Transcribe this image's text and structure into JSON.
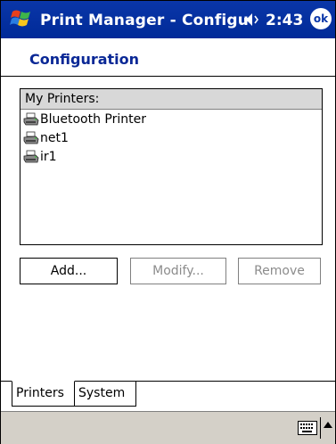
{
  "titlebar": {
    "title": "Print Manager - Configu",
    "clock": "2:43",
    "ok_label": "ok"
  },
  "page": {
    "title": "Configuration"
  },
  "printer_list": {
    "header": "My Printers:",
    "items": [
      {
        "label": "Bluetooth Printer",
        "icon": "printer-icon"
      },
      {
        "label": "net1",
        "icon": "printer-icon"
      },
      {
        "label": "ir1",
        "icon": "printer-icon"
      }
    ]
  },
  "buttons": {
    "add": "Add...",
    "modify": "Modify...",
    "remove": "Remove"
  },
  "tabs": [
    {
      "label": "Printers",
      "selected": true
    },
    {
      "label": "System",
      "selected": false
    }
  ],
  "colors": {
    "titlebar": "#0a36a8",
    "heading_text": "#0a2896",
    "disabled_text": "#8c8c8c",
    "menubar": "#d4d0c8"
  }
}
